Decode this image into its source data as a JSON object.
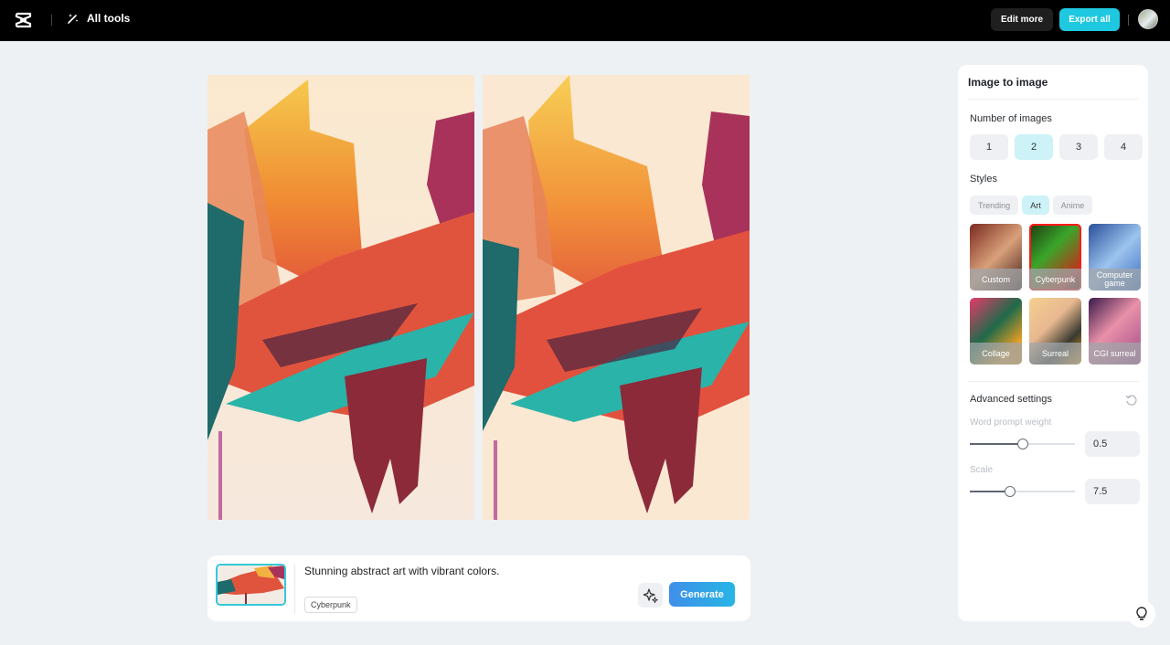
{
  "topbar": {
    "all_tools_label": "All tools",
    "edit_more_label": "Edit more",
    "export_all_label": "Export all",
    "logo_icon": "capcut-logo-icon",
    "all_tools_icon": "magic-wand-icon"
  },
  "canvas": {
    "images": [
      {
        "name": "generated-image-1"
      },
      {
        "name": "generated-image-2"
      }
    ]
  },
  "prompt": {
    "text": "Stunning abstract art with vibrant colors.",
    "style_tag": "Cyberpunk",
    "magic_icon": "sparkle-icon",
    "generate_label": "Generate"
  },
  "panel": {
    "title": "Image to image",
    "number_label": "Number of images",
    "numbers": [
      "1",
      "2",
      "3",
      "4"
    ],
    "selected_number": "2",
    "styles_label": "Styles",
    "style_tabs": [
      "Trending",
      "Art",
      "Anime"
    ],
    "selected_tab": "Art",
    "styles": [
      {
        "label": "Custom"
      },
      {
        "label": "Cyberpunk",
        "selected": true
      },
      {
        "label": "Computer game"
      },
      {
        "label": "Collage"
      },
      {
        "label": "Surreal"
      },
      {
        "label": "CGI surreal"
      }
    ],
    "advanced_label": "Advanced settings",
    "word_prompt_label": "Word prompt weight",
    "word_prompt_value": "0.5",
    "word_prompt_fraction": 0.5,
    "scale_label": "Scale",
    "scale_value": "7.5",
    "scale_fraction": 0.38
  },
  "colors": {
    "accent": "#1ec8e0",
    "selected_bg": "#cdf2f7",
    "generate_start": "#3f8fe8",
    "generate_end": "#27b5e6",
    "selected_outline": "#ff1a1a"
  }
}
